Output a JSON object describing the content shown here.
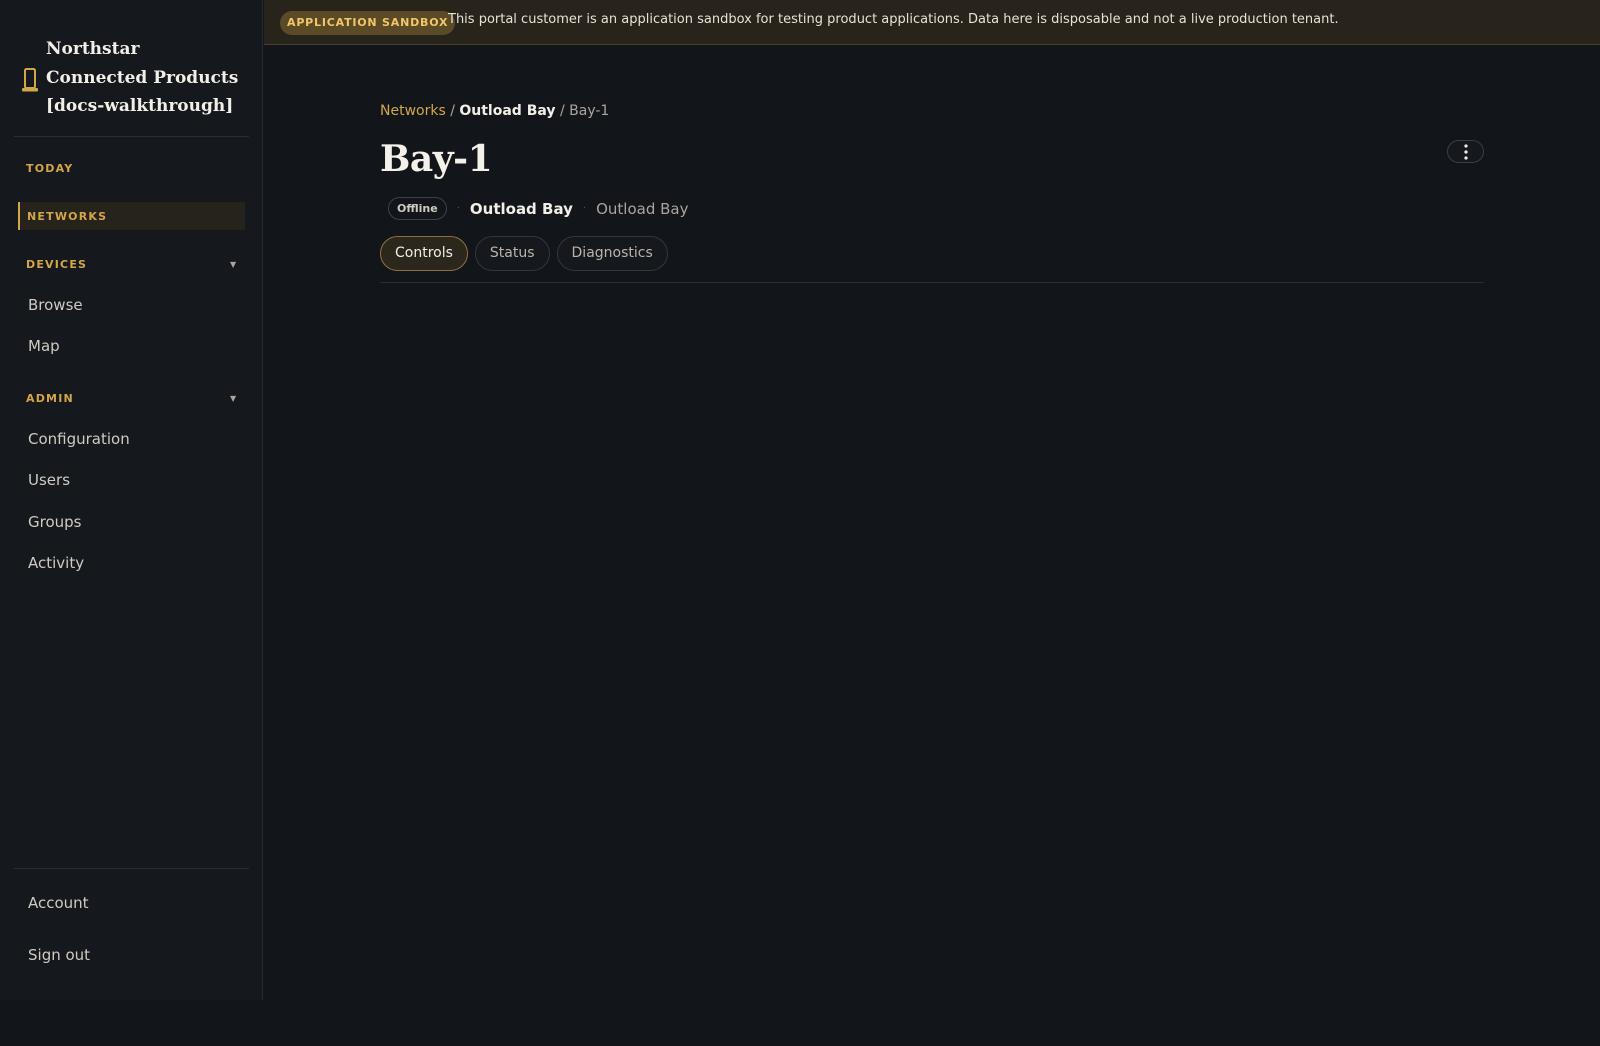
{
  "brand": {
    "name": "Northstar Connected Products [docs-walkthrough]",
    "accent": "#d4a64a"
  },
  "sidebar": {
    "today": "TODAY",
    "networks": "NETWORKS",
    "devices": {
      "label": "DEVICES",
      "items": [
        "Browse",
        "Map"
      ]
    },
    "admin": {
      "label": "ADMIN",
      "items": [
        "Configuration",
        "Users",
        "Groups",
        "Activity"
      ]
    },
    "footer": {
      "account": "Account",
      "sign_out": "Sign out"
    }
  },
  "banner": {
    "badge": "APPLICATION SANDBOX",
    "text": "This portal customer is an application sandbox for testing product applications. Data here is disposable and not a live production tenant."
  },
  "breadcrumb": {
    "networks": "Networks",
    "network": "Outload Bay",
    "current": "Bay-1",
    "separator": "/"
  },
  "page": {
    "title": "Bay-1",
    "status": "Offline",
    "network": "Outload Bay",
    "location": "Outload Bay"
  },
  "tabs": [
    {
      "label": "Controls",
      "active": true
    },
    {
      "label": "Status",
      "active": false
    },
    {
      "label": "Diagnostics",
      "active": false
    }
  ],
  "icons": {
    "brand": "device-icon",
    "more": "more-vertical-icon",
    "caret": "caret-down-icon"
  }
}
